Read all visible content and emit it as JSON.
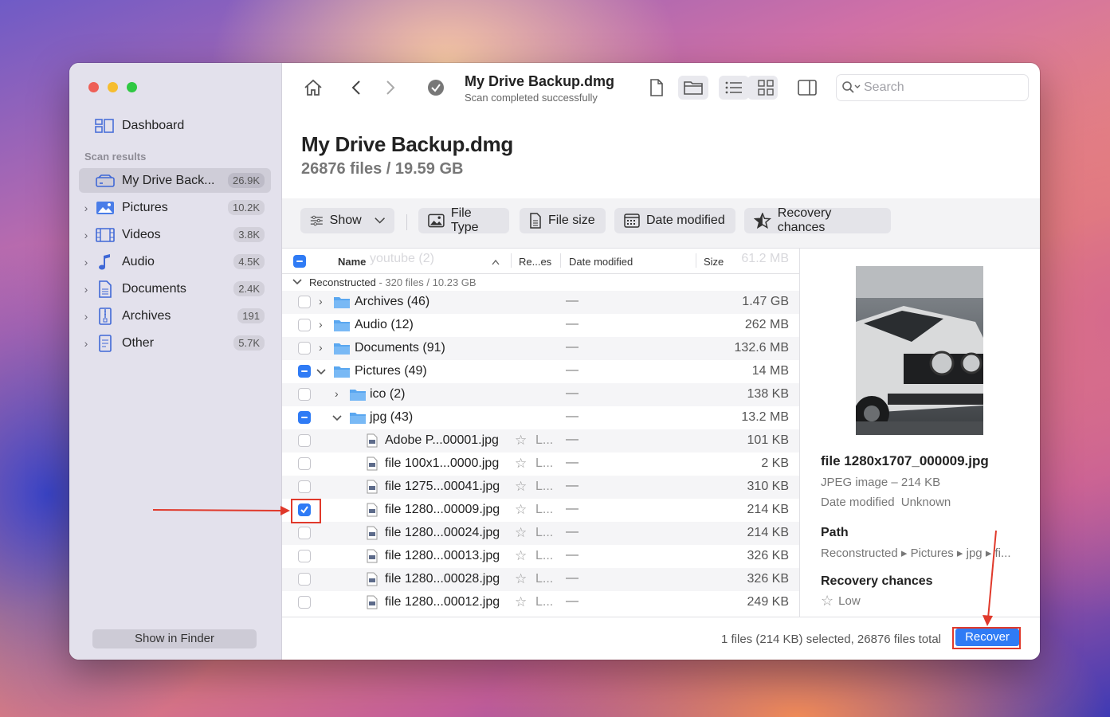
{
  "sidebar": {
    "dashboard_label": "Dashboard",
    "section_title": "Scan results",
    "items": [
      {
        "label": "My Drive Back...",
        "count": "26.9K"
      },
      {
        "label": "Pictures",
        "count": "10.2K"
      },
      {
        "label": "Videos",
        "count": "3.8K"
      },
      {
        "label": "Audio",
        "count": "4.5K"
      },
      {
        "label": "Documents",
        "count": "2.4K"
      },
      {
        "label": "Archives",
        "count": "191"
      },
      {
        "label": "Other",
        "count": "5.7K"
      }
    ],
    "show_in_finder": "Show in Finder"
  },
  "toolbar": {
    "title": "My Drive Backup.dmg",
    "subtitle": "Scan completed successfully",
    "search_placeholder": "Search"
  },
  "header": {
    "title": "My Drive Backup.dmg",
    "subtitle": "26876 files / 19.59 GB"
  },
  "filters": {
    "show": "Show",
    "file_type": "File Type",
    "file_size": "File size",
    "date_modified": "Date modified",
    "recovery_chances": "Recovery chances"
  },
  "list": {
    "columns": {
      "name": "Name",
      "recovery": "Re...es",
      "date": "Date modified",
      "size": "Size"
    },
    "ghost_row": {
      "name": "youtube (2)",
      "size": "61.2 MB"
    },
    "group": {
      "name": "Reconstructed",
      "info": " - 320 files / 10.23 GB"
    },
    "rows": [
      {
        "name": "Archives (46)",
        "date": "—",
        "size": "1.47 GB"
      },
      {
        "name": "Audio (12)",
        "date": "—",
        "size": "262 MB"
      },
      {
        "name": "Documents (91)",
        "date": "—",
        "size": "132.6 MB"
      },
      {
        "name": "Pictures (49)",
        "date": "—",
        "size": "14 MB"
      },
      {
        "name": "ico (2)",
        "date": "—",
        "size": "138 KB"
      },
      {
        "name": "jpg (43)",
        "date": "—",
        "size": "13.2 MB"
      },
      {
        "name": "Adobe P...00001.jpg",
        "rec": "L...",
        "date": "—",
        "size": "101 KB"
      },
      {
        "name": "file 100x1...0000.jpg",
        "rec": "L...",
        "date": "—",
        "size": "2 KB"
      },
      {
        "name": "file 1275...00041.jpg",
        "rec": "L...",
        "date": "—",
        "size": "310 KB"
      },
      {
        "name": "file 1280...00009.jpg",
        "rec": "L...",
        "date": "—",
        "size": "214 KB"
      },
      {
        "name": "file 1280...00024.jpg",
        "rec": "L...",
        "date": "—",
        "size": "214 KB"
      },
      {
        "name": "file 1280...00013.jpg",
        "rec": "L...",
        "date": "—",
        "size": "326 KB"
      },
      {
        "name": "file 1280...00028.jpg",
        "rec": "L...",
        "date": "—",
        "size": "326 KB"
      },
      {
        "name": "file 1280...00012.jpg",
        "rec": "L...",
        "date": "—",
        "size": "249 KB"
      }
    ]
  },
  "preview": {
    "filename": "file 1280x1707_000009.jpg",
    "type": "JPEG image – 214 KB",
    "date_label": "Date modified",
    "date_value": "Unknown",
    "path_label": "Path",
    "path_value": "Reconstructed ▸ Pictures ▸ jpg ▸ fi...",
    "recovery_label": "Recovery chances",
    "recovery_value": "Low"
  },
  "status": {
    "text": "1 files (214 KB) selected, 26876 files total",
    "recover": "Recover"
  },
  "colors": {
    "accent": "#2f7bf5",
    "annotation": "#e0392b"
  }
}
